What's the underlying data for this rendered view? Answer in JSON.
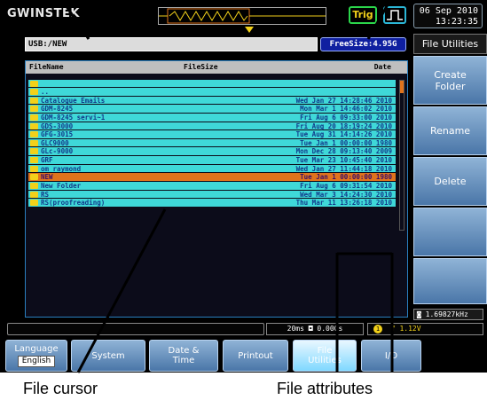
{
  "header": {
    "logo": "GWINSTEK",
    "trigger_label": "Trig",
    "date": "06 Sep 2010",
    "time": "13:23:35"
  },
  "path": {
    "current": "USB:/NEW",
    "free_size": "FreeSize:4.95G"
  },
  "file_list": {
    "columns": [
      "FileName",
      "FileSize",
      "Date"
    ],
    "parent_entry": "..",
    "rows": [
      {
        "name": "Catalogue Emails",
        "date": "Wed Jan 27 14:28:46 2010",
        "selected": false
      },
      {
        "name": "GDM-8245",
        "date": "Mon Mar  1 14:46:02 2010",
        "selected": false
      },
      {
        "name": "GDM-8245 servi~1",
        "date": "Fri Aug  6 09:33:00 2010",
        "selected": false
      },
      {
        "name": "GDS-3000",
        "date": "Fri Aug 20 18:19:24 2010",
        "selected": false
      },
      {
        "name": "GFG-3015",
        "date": "Tue Aug 31 14:14:26 2010",
        "selected": false
      },
      {
        "name": "GLC9000",
        "date": "Tue Jan  1 00:00:00 1980",
        "selected": false
      },
      {
        "name": "GLc-9000",
        "date": "Mon Dec 28 09:13:40 2009",
        "selected": false
      },
      {
        "name": "GRF",
        "date": "Tue Mar 23 10:45:40 2010",
        "selected": false
      },
      {
        "name": "om raymond",
        "date": "Wed Jan 27 11:44:18 2010",
        "selected": false
      },
      {
        "name": "NEW",
        "date": "Tue Jan  1 00:00:00 1980",
        "selected": true
      },
      {
        "name": "New Folder",
        "date": "Fri Aug  6 09:31:54 2010",
        "selected": false
      },
      {
        "name": "RS",
        "date": "Wed Mar  3 14:24:30 2010",
        "selected": false
      },
      {
        "name": "RS(proofreading)",
        "date": "Thu Mar 11 13:26:18 2010",
        "selected": false
      }
    ]
  },
  "menu": {
    "title": "File Utilities",
    "buttons": [
      "Create\nFolder",
      "Rename",
      "Delete",
      "",
      ""
    ]
  },
  "status": {
    "frequency": "1.69827kHz",
    "timebase": "20ms",
    "delay": "0.000s",
    "trigger_level": "1.12V",
    "trigger_channel": "1"
  },
  "tabs": [
    {
      "label": "Language",
      "sub": "English",
      "active": false
    },
    {
      "label": "System",
      "sub": "",
      "active": false
    },
    {
      "label": "Date &\nTime",
      "sub": "",
      "active": false
    },
    {
      "label": "Printout",
      "sub": "",
      "active": false
    },
    {
      "label": "File\nUtilities",
      "sub": "",
      "active": true
    },
    {
      "label": "I/O",
      "sub": "",
      "active": false
    }
  ],
  "callouts": {
    "file_cursor": "File cursor",
    "file_attributes": "File attributes"
  },
  "colors": {
    "row_bg": "#3fd8d8",
    "selected_row_bg": "#e0731c",
    "accent_blue": "#0f1fa0",
    "trigger_yellow": "#f2d11a"
  }
}
